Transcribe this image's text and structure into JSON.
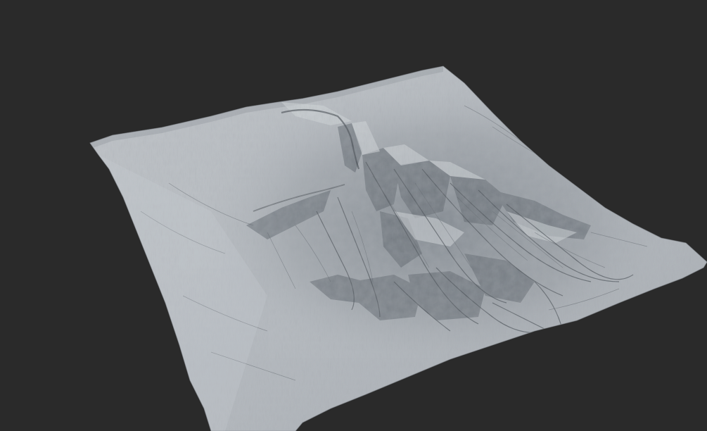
{
  "scene": {
    "background_color": "#2a2a2a",
    "subject": "terrain-heightmap-render",
    "surface_color": "#b9bec3",
    "shadow_color": "#3f4449",
    "highlight_color": "#d9dde1"
  }
}
